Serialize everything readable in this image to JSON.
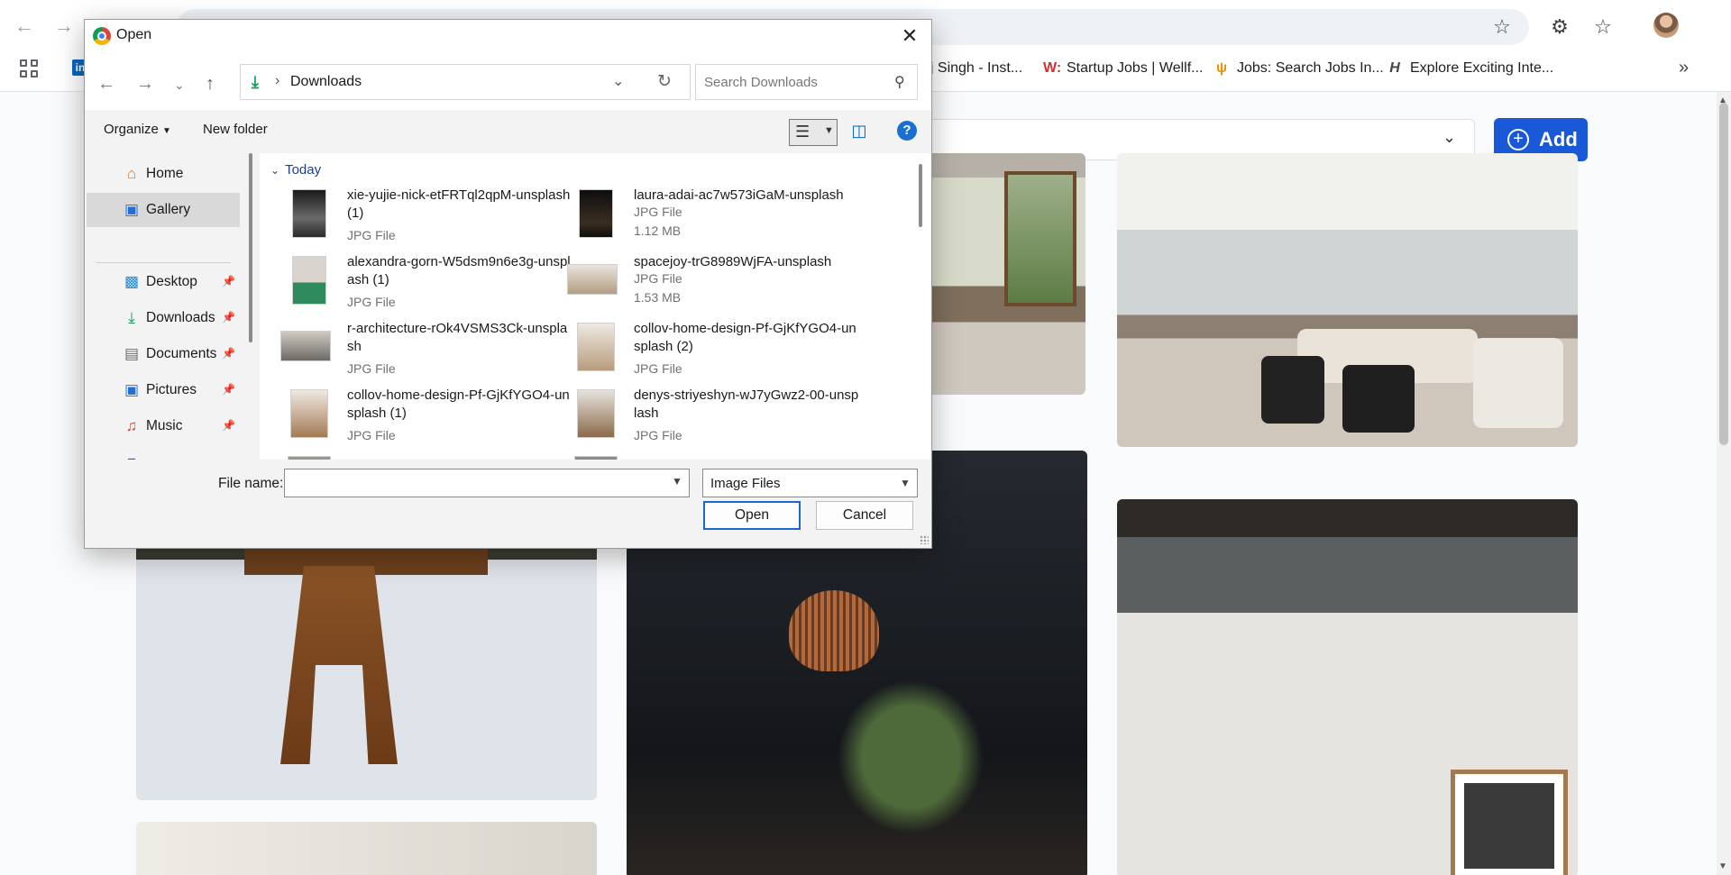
{
  "browser": {
    "bookmarks": [
      {
        "icon": "",
        "label": "aj Singh - Inst..."
      },
      {
        "icon": "W:",
        "label": "Startup Jobs | Wellf..."
      },
      {
        "icon": "ψ",
        "label": "Jobs: Search Jobs In..."
      },
      {
        "icon": "H",
        "label": "Explore Exciting Inte..."
      }
    ]
  },
  "page": {
    "add_label": "Add"
  },
  "dialog": {
    "title": "Open",
    "address_path": "Downloads",
    "search_placeholder": "Search Downloads",
    "toolbar": {
      "organize": "Organize",
      "new_folder": "New folder"
    },
    "nav_items": [
      {
        "label": "Home",
        "icon": "home-icon"
      },
      {
        "label": "Gallery",
        "icon": "gallery-icon"
      },
      {
        "label": "Desktop",
        "icon": "desktop-icon"
      },
      {
        "label": "Downloads",
        "icon": "downloads-icon"
      },
      {
        "label": "Documents",
        "icon": "documents-icon"
      },
      {
        "label": "Pictures",
        "icon": "pictures-icon"
      },
      {
        "label": "Music",
        "icon": "music-icon"
      }
    ],
    "group_header": "Today",
    "files": [
      {
        "name": "xie-yujie-nick-etFRTql2qpM-unsplash (1)",
        "type": "JPG File",
        "size": ""
      },
      {
        "name": "laura-adai-ac7w573iGaM-unsplash",
        "type": "JPG File",
        "size": "1.12 MB"
      },
      {
        "name": "alexandra-gorn-W5dsm9n6e3g-unsplash (1)",
        "type": "JPG File",
        "size": ""
      },
      {
        "name": "spacejoy-trG8989WjFA-unsplash",
        "type": "JPG File",
        "size": "1.53 MB"
      },
      {
        "name": "r-architecture-rOk4VSMS3Ck-unsplash",
        "type": "JPG File",
        "size": ""
      },
      {
        "name": "collov-home-design-Pf-GjKfYGO4-unsplash (2)",
        "type": "JPG File",
        "size": ""
      },
      {
        "name": "collov-home-design-Pf-GjKfYGO4-unsplash (1)",
        "type": "JPG File",
        "size": ""
      },
      {
        "name": "denys-striyeshyn-wJ7yGwz2-00-unsplash",
        "type": "JPG File",
        "size": ""
      }
    ],
    "file_name_label": "File name:",
    "file_name_value": "",
    "file_type": "Image Files",
    "open_button": "Open",
    "cancel_button": "Cancel"
  }
}
